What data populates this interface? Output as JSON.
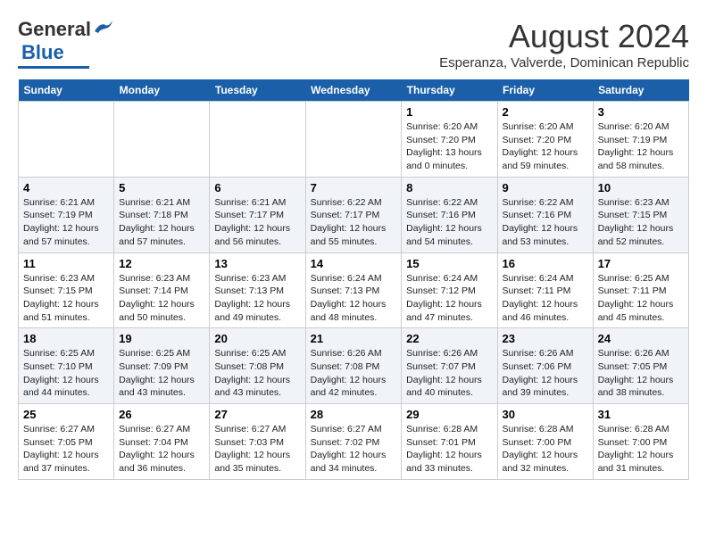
{
  "logo": {
    "general": "General",
    "blue": "Blue"
  },
  "title": {
    "month_year": "August 2024",
    "location": "Esperanza, Valverde, Dominican Republic"
  },
  "days_of_week": [
    "Sunday",
    "Monday",
    "Tuesday",
    "Wednesday",
    "Thursday",
    "Friday",
    "Saturday"
  ],
  "weeks": [
    [
      {
        "day": "",
        "info": ""
      },
      {
        "day": "",
        "info": ""
      },
      {
        "day": "",
        "info": ""
      },
      {
        "day": "",
        "info": ""
      },
      {
        "day": "1",
        "info": "Sunrise: 6:20 AM\nSunset: 7:20 PM\nDaylight: 13 hours and 0 minutes."
      },
      {
        "day": "2",
        "info": "Sunrise: 6:20 AM\nSunset: 7:20 PM\nDaylight: 12 hours and 59 minutes."
      },
      {
        "day": "3",
        "info": "Sunrise: 6:20 AM\nSunset: 7:19 PM\nDaylight: 12 hours and 58 minutes."
      }
    ],
    [
      {
        "day": "4",
        "info": "Sunrise: 6:21 AM\nSunset: 7:19 PM\nDaylight: 12 hours and 57 minutes."
      },
      {
        "day": "5",
        "info": "Sunrise: 6:21 AM\nSunset: 7:18 PM\nDaylight: 12 hours and 57 minutes."
      },
      {
        "day": "6",
        "info": "Sunrise: 6:21 AM\nSunset: 7:17 PM\nDaylight: 12 hours and 56 minutes."
      },
      {
        "day": "7",
        "info": "Sunrise: 6:22 AM\nSunset: 7:17 PM\nDaylight: 12 hours and 55 minutes."
      },
      {
        "day": "8",
        "info": "Sunrise: 6:22 AM\nSunset: 7:16 PM\nDaylight: 12 hours and 54 minutes."
      },
      {
        "day": "9",
        "info": "Sunrise: 6:22 AM\nSunset: 7:16 PM\nDaylight: 12 hours and 53 minutes."
      },
      {
        "day": "10",
        "info": "Sunrise: 6:23 AM\nSunset: 7:15 PM\nDaylight: 12 hours and 52 minutes."
      }
    ],
    [
      {
        "day": "11",
        "info": "Sunrise: 6:23 AM\nSunset: 7:15 PM\nDaylight: 12 hours and 51 minutes."
      },
      {
        "day": "12",
        "info": "Sunrise: 6:23 AM\nSunset: 7:14 PM\nDaylight: 12 hours and 50 minutes."
      },
      {
        "day": "13",
        "info": "Sunrise: 6:23 AM\nSunset: 7:13 PM\nDaylight: 12 hours and 49 minutes."
      },
      {
        "day": "14",
        "info": "Sunrise: 6:24 AM\nSunset: 7:13 PM\nDaylight: 12 hours and 48 minutes."
      },
      {
        "day": "15",
        "info": "Sunrise: 6:24 AM\nSunset: 7:12 PM\nDaylight: 12 hours and 47 minutes."
      },
      {
        "day": "16",
        "info": "Sunrise: 6:24 AM\nSunset: 7:11 PM\nDaylight: 12 hours and 46 minutes."
      },
      {
        "day": "17",
        "info": "Sunrise: 6:25 AM\nSunset: 7:11 PM\nDaylight: 12 hours and 45 minutes."
      }
    ],
    [
      {
        "day": "18",
        "info": "Sunrise: 6:25 AM\nSunset: 7:10 PM\nDaylight: 12 hours and 44 minutes."
      },
      {
        "day": "19",
        "info": "Sunrise: 6:25 AM\nSunset: 7:09 PM\nDaylight: 12 hours and 43 minutes."
      },
      {
        "day": "20",
        "info": "Sunrise: 6:25 AM\nSunset: 7:08 PM\nDaylight: 12 hours and 43 minutes."
      },
      {
        "day": "21",
        "info": "Sunrise: 6:26 AM\nSunset: 7:08 PM\nDaylight: 12 hours and 42 minutes."
      },
      {
        "day": "22",
        "info": "Sunrise: 6:26 AM\nSunset: 7:07 PM\nDaylight: 12 hours and 40 minutes."
      },
      {
        "day": "23",
        "info": "Sunrise: 6:26 AM\nSunset: 7:06 PM\nDaylight: 12 hours and 39 minutes."
      },
      {
        "day": "24",
        "info": "Sunrise: 6:26 AM\nSunset: 7:05 PM\nDaylight: 12 hours and 38 minutes."
      }
    ],
    [
      {
        "day": "25",
        "info": "Sunrise: 6:27 AM\nSunset: 7:05 PM\nDaylight: 12 hours and 37 minutes."
      },
      {
        "day": "26",
        "info": "Sunrise: 6:27 AM\nSunset: 7:04 PM\nDaylight: 12 hours and 36 minutes."
      },
      {
        "day": "27",
        "info": "Sunrise: 6:27 AM\nSunset: 7:03 PM\nDaylight: 12 hours and 35 minutes."
      },
      {
        "day": "28",
        "info": "Sunrise: 6:27 AM\nSunset: 7:02 PM\nDaylight: 12 hours and 34 minutes."
      },
      {
        "day": "29",
        "info": "Sunrise: 6:28 AM\nSunset: 7:01 PM\nDaylight: 12 hours and 33 minutes."
      },
      {
        "day": "30",
        "info": "Sunrise: 6:28 AM\nSunset: 7:00 PM\nDaylight: 12 hours and 32 minutes."
      },
      {
        "day": "31",
        "info": "Sunrise: 6:28 AM\nSunset: 7:00 PM\nDaylight: 12 hours and 31 minutes."
      }
    ]
  ]
}
